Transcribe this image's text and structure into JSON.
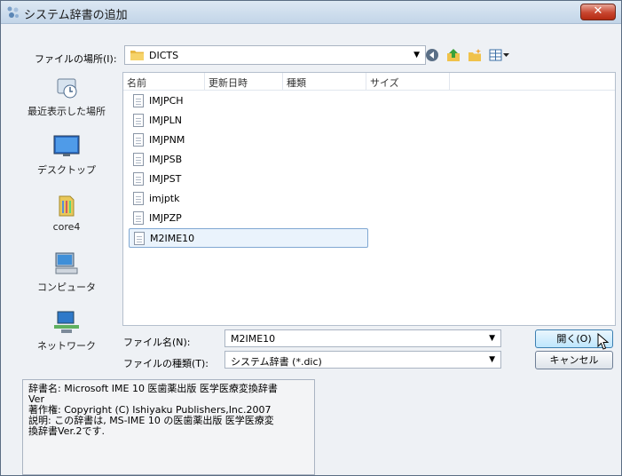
{
  "window": {
    "title": "システム辞書の追加",
    "close_label": "✕"
  },
  "lookin": {
    "label": "ファイルの場所(I):",
    "value": "DICTS"
  },
  "toolbar": {
    "icons": [
      "back-icon",
      "up-folder-icon",
      "new-folder-icon",
      "view-menu-icon"
    ]
  },
  "places": [
    {
      "label": "最近表示した場所",
      "icon": "recent-places-icon"
    },
    {
      "label": "デスクトップ",
      "icon": "desktop-icon"
    },
    {
      "label": "core4",
      "icon": "user-folder-icon"
    },
    {
      "label": "コンピュータ",
      "icon": "computer-icon"
    },
    {
      "label": "ネットワーク",
      "icon": "network-icon"
    }
  ],
  "columns": [
    "名前",
    "更新日時",
    "種類",
    "サイズ"
  ],
  "files": [
    "IMJPCH",
    "IMJPLN",
    "IMJPNM",
    "IMJPSB",
    "IMJPST",
    "imjptk",
    "IMJPZP",
    "M2IME10"
  ],
  "filename": {
    "label": "ファイル名(N):",
    "value": "M2IME10"
  },
  "filetype": {
    "label": "ファイルの種類(T):",
    "value": "システム辞書 (*.dic)"
  },
  "buttons": {
    "open": "開く(O)",
    "cancel": "キャンセル"
  },
  "description": "辞書名: Microsoft IME 10 医歯薬出版 医学医療変換辞書\nVer\n著作権: Copyright (C) Ishiyaku Publishers,Inc.2007\n説明: この辞書は, MS-IME 10 の医歯薬出版 医学医療変\n換辞書Ver.2です.",
  "colors": {
    "selection_border": "#80a8d2",
    "selection_fill": "#eaf3fc",
    "close_button": "#c8462f"
  }
}
